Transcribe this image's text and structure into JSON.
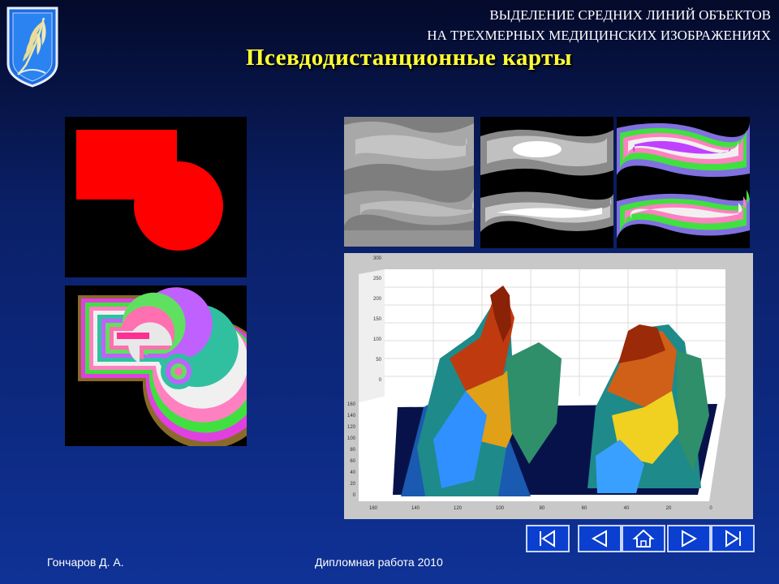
{
  "header": {
    "line1": "ВЫДЕЛЕНИЕ СРЕДНИХ ЛИНИЙ ОБЪЕКТОВ",
    "line2": "НА ТРЕХМЕРНЫХ МЕДИЦИНСКИХ ИЗОБРАЖЕНИЯХ",
    "title": "Псевдодистанционные карты"
  },
  "surface_plot": {
    "y_ticks": [
      "300",
      "250",
      "200",
      "150",
      "100",
      "50",
      "0"
    ],
    "z_ticks": [
      "160",
      "140",
      "120",
      "100",
      "80",
      "60",
      "40",
      "20",
      "0"
    ],
    "x_ticks": [
      "160",
      "140",
      "120",
      "100",
      "80",
      "60",
      "40",
      "20",
      "0"
    ]
  },
  "footer": {
    "author": "Гончаров Д. А.",
    "work": "Дипломная работа 2010"
  },
  "nav_icons": [
    "first-slide-icon",
    "prev-slide-icon",
    "home-icon",
    "next-slide-icon",
    "last-slide-icon"
  ],
  "colors": {
    "title": "#ffff33",
    "shape": "#ff0000",
    "nav_button": "#0a3fcf"
  }
}
